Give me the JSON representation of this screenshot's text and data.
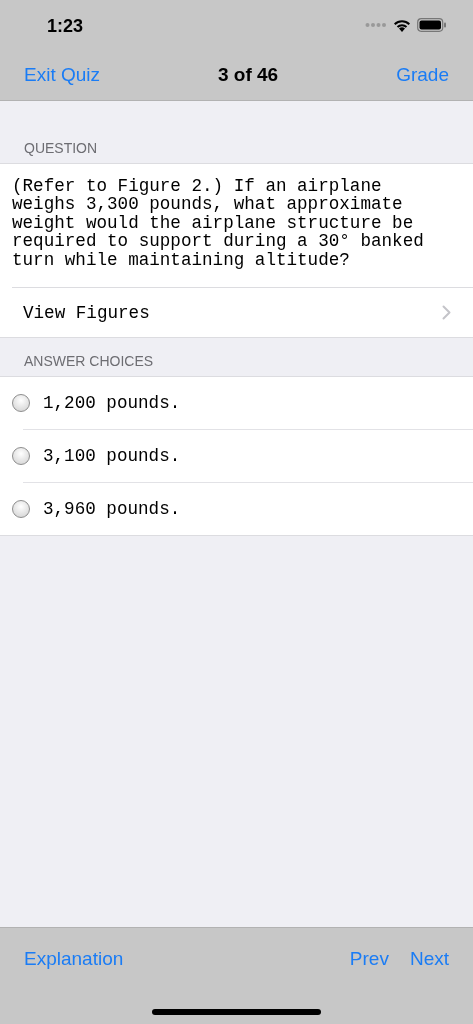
{
  "status_bar": {
    "time": "1:23"
  },
  "nav_bar": {
    "left": "Exit Quiz",
    "title": "3 of 46",
    "right": "Grade"
  },
  "question": {
    "header": "QUESTION",
    "text": "(Refer to Figure 2.) If an airplane weighs 3,300 pounds, what approximate weight would the airplane structure be required to support during a 30° banked turn while maintaining altitude?",
    "link": "View Figures"
  },
  "answers": {
    "header": "ANSWER CHOICES",
    "choices": [
      {
        "text": "1,200 pounds.",
        "selected": false
      },
      {
        "text": "3,100 pounds.",
        "selected": false
      },
      {
        "text": "3,960 pounds.",
        "selected": false
      }
    ]
  },
  "toolbar": {
    "left": "Explanation",
    "buttons": [
      "Prev",
      "Next"
    ]
  }
}
